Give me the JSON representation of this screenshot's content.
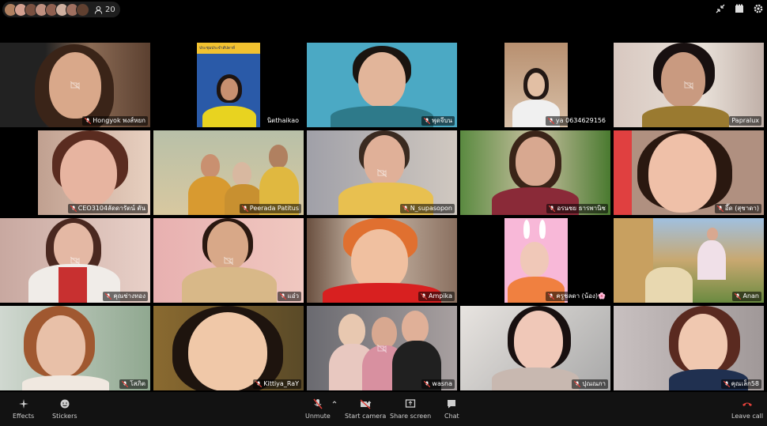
{
  "header": {
    "participant_count": "20",
    "avatar_colors": [
      "#b08060",
      "#d4a090",
      "#7a5040",
      "#c09080",
      "#906050",
      "#d0b0a0",
      "#a07060",
      "#604030"
    ],
    "icons": [
      "minimize-icon",
      "gallery-view-icon",
      "settings-gear-icon"
    ]
  },
  "participants": [
    {
      "name": "Hongyok พงส์หยก",
      "muted": true,
      "cam_icon": true
    },
    {
      "name": "นิตthaikao",
      "muted": false,
      "banner": "ประชุมประจำสัปดาห์"
    },
    {
      "name": "พุดจีบน",
      "muted": true
    },
    {
      "name": "ya 0634629156",
      "muted": true,
      "active_speaker": true
    },
    {
      "name": "Papralux",
      "muted": false,
      "cam_icon": true
    },
    {
      "name": "CEO3104ลัดดารัตน์ ตัน",
      "muted": true
    },
    {
      "name": "Peerada Patitus",
      "muted": true
    },
    {
      "name": "N_supasopon",
      "muted": true,
      "cam_icon": true
    },
    {
      "name": "อรนชย ธารพานิช",
      "muted": true
    },
    {
      "name": "อี๊ด (สุชาดา)",
      "muted": true
    },
    {
      "name": "คุณช่างทอง",
      "muted": true,
      "cam_icon": true
    },
    {
      "name": "แอ๋ว",
      "muted": true,
      "cam_icon": true
    },
    {
      "name": "Ampika",
      "muted": true
    },
    {
      "name": "ครูชลดา (น้อง)🌸",
      "muted": true
    },
    {
      "name": "Anan",
      "muted": true
    },
    {
      "name": "โสภิต",
      "muted": true
    },
    {
      "name": "Kittiya_RaY",
      "muted": true
    },
    {
      "name": "wasna",
      "muted": true,
      "cam_icon": true
    },
    {
      "name": "ปุณณภา",
      "muted": true
    },
    {
      "name": "คุณเล็ก58",
      "muted": true
    }
  ],
  "toolbar": {
    "effects": "Effects",
    "stickers": "Stickers",
    "unmute": "Unmute",
    "start_camera": "Start camera",
    "share_screen": "Share screen",
    "chat": "Chat",
    "leave_call": "Leave call",
    "leave_color": "#e0413a"
  }
}
